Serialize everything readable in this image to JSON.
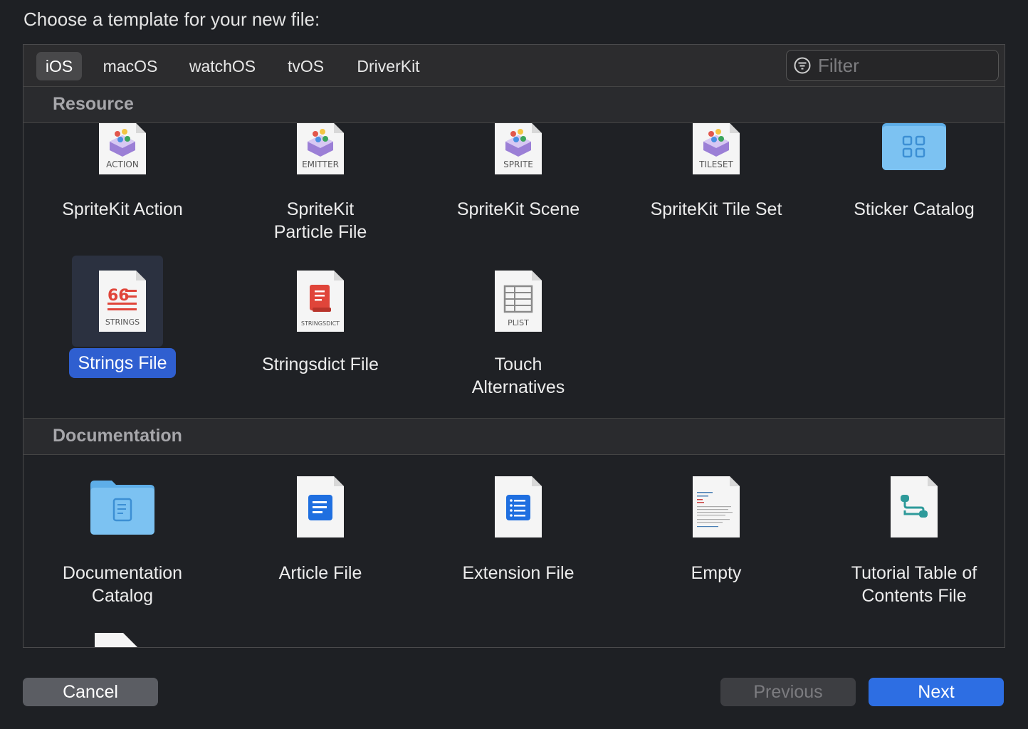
{
  "prompt": "Choose a template for your new file:",
  "tabs": [
    {
      "label": "iOS",
      "active": true
    },
    {
      "label": "macOS"
    },
    {
      "label": "watchOS"
    },
    {
      "label": "tvOS"
    },
    {
      "label": "DriverKit"
    }
  ],
  "filter": {
    "placeholder": "Filter",
    "value": ""
  },
  "sections": [
    {
      "title": "Resource",
      "items": [
        {
          "label": "SpriteKit Action",
          "badge": "ACTION",
          "icon": "spritekit-icon"
        },
        {
          "label": "SpriteKit\nParticle File",
          "badge": "EMITTER",
          "icon": "spritekit-icon"
        },
        {
          "label": "SpriteKit Scene",
          "badge": "SPRITE",
          "icon": "spritekit-icon"
        },
        {
          "label": "SpriteKit Tile Set",
          "badge": "TILESET",
          "icon": "spritekit-icon"
        },
        {
          "label": "Sticker Catalog",
          "icon": "sticker-catalog-icon"
        },
        {
          "label": "Strings File",
          "badge": "STRINGS",
          "icon": "strings-file-icon",
          "selected": true
        },
        {
          "label": "Stringsdict File",
          "badge": "STRINGSDICT",
          "icon": "stringsdict-icon"
        },
        {
          "label": "Touch\nAlternatives",
          "badge": "PLIST",
          "icon": "plist-icon"
        }
      ]
    },
    {
      "title": "Documentation",
      "items": [
        {
          "label": "Documentation\nCatalog",
          "icon": "folder-doc-icon"
        },
        {
          "label": "Article File",
          "icon": "article-icon"
        },
        {
          "label": "Extension File",
          "icon": "extension-icon"
        },
        {
          "label": "Empty",
          "icon": "empty-file-icon"
        },
        {
          "label": "Tutorial Table of\nContents File",
          "icon": "tutorial-toc-icon"
        }
      ]
    }
  ],
  "buttons": {
    "cancel": "Cancel",
    "previous": "Previous",
    "next": "Next"
  },
  "colors": {
    "accent": "#2d6ee3",
    "selection": "#2f5fd0",
    "background": "#1e2024"
  }
}
